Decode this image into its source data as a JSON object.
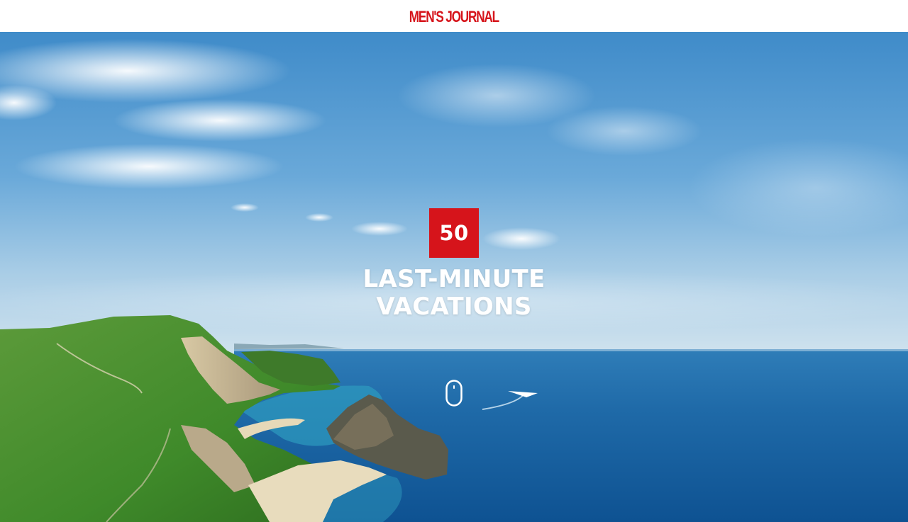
{
  "header": {
    "logo_text": "MEN'S JOURNAL",
    "logo_color": "#d6141b"
  },
  "hero": {
    "badge_number": "50",
    "badge_color": "#d6141b",
    "title_line_1": "LAST-MINUTE",
    "title_line_2": "VACATIONS",
    "scroll_icon": "mouse-scroll-icon",
    "image_alt": "coastal cliffs and sea under blue sky"
  }
}
